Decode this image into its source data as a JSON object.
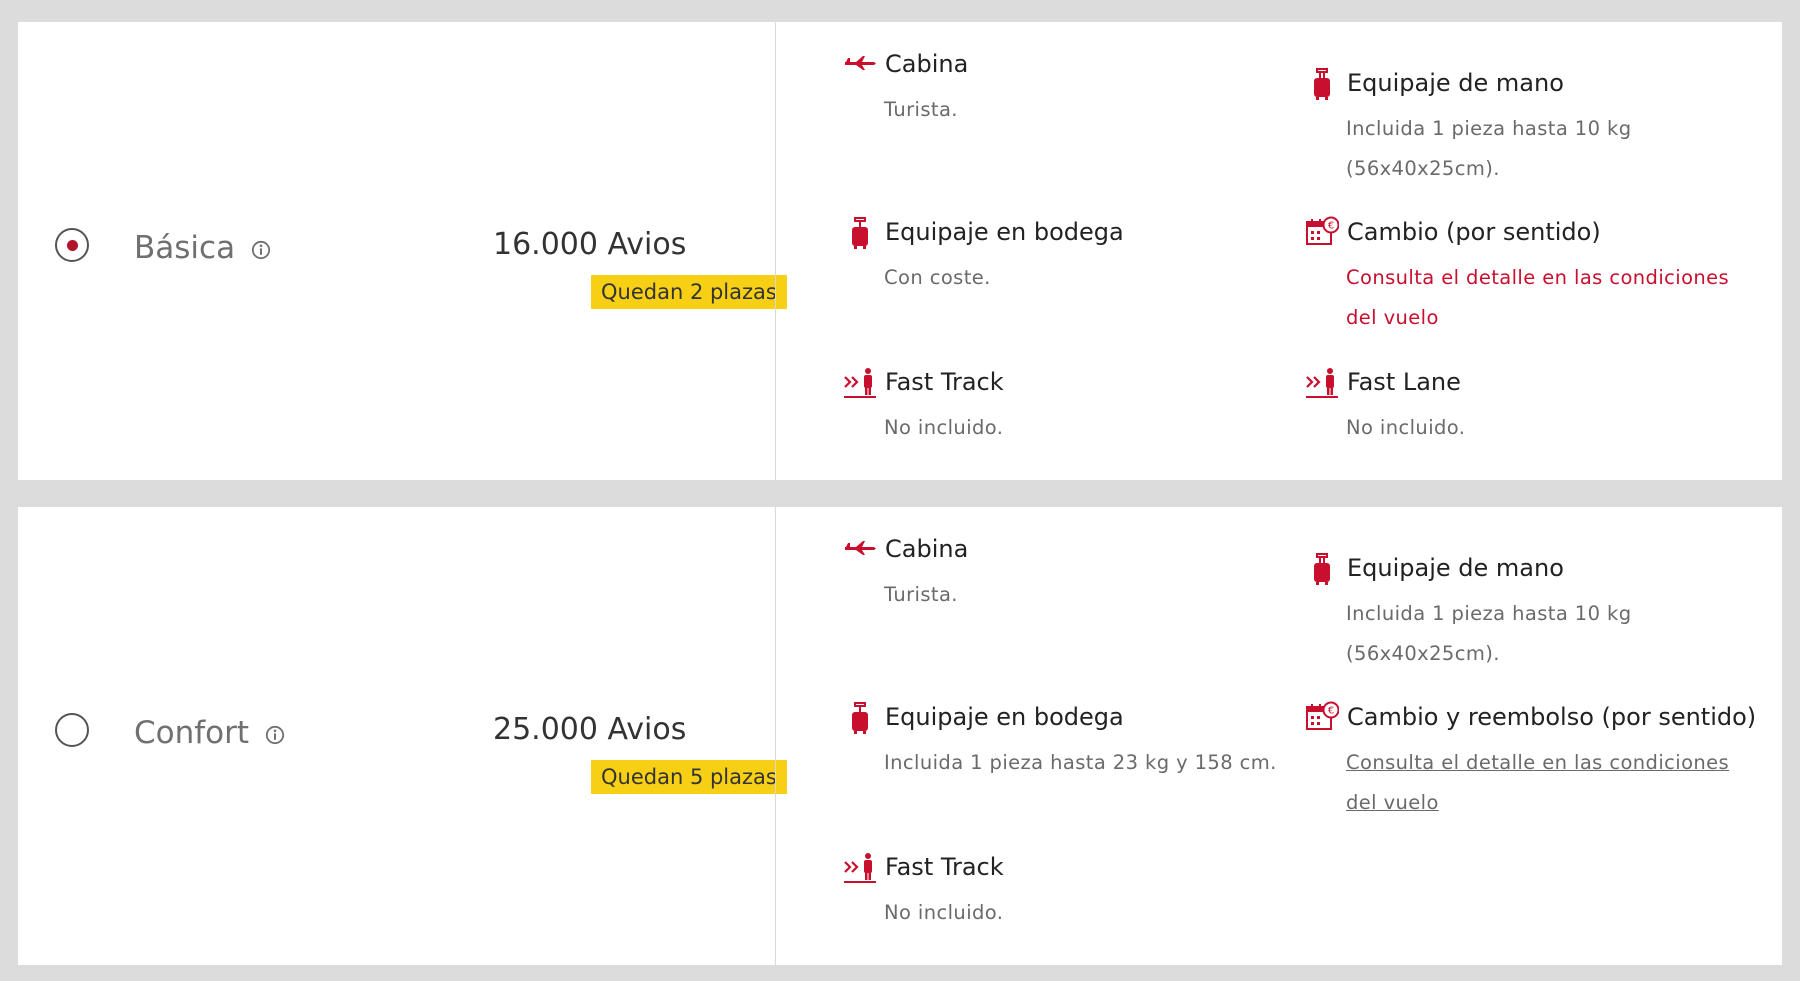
{
  "accent_color": "#c8102e",
  "badge_color": "#f7d016",
  "fares": [
    {
      "name": "Básica",
      "selected": true,
      "price": "16.000 Avios",
      "seats": "Quedan 2 plazas",
      "features": {
        "cabin": {
          "icon": "plane-icon",
          "title": "Cabina",
          "desc": "Turista."
        },
        "hand_baggage": {
          "icon": "suitcase-icon",
          "title": "Equipaje de mano",
          "desc": "Incluida 1 pieza hasta 10 kg (56x40x25cm)."
        },
        "hold_baggage": {
          "icon": "suitcase-icon",
          "title": "Equipaje en bodega",
          "desc": "Con coste."
        },
        "change": {
          "icon": "calendar-euro-icon",
          "title": "Cambio (por sentido)",
          "desc": "Consulta el detalle en las condiciones del vuelo"
        },
        "fast_track": {
          "icon": "fast-track-icon",
          "title": "Fast Track",
          "desc": "No incluido."
        },
        "fast_lane": {
          "icon": "fast-track-icon",
          "title": "Fast Lane",
          "desc": "No incluido."
        }
      }
    },
    {
      "name": "Confort",
      "selected": false,
      "price": "25.000 Avios",
      "seats": "Quedan 5 plazas",
      "features": {
        "cabin": {
          "icon": "plane-icon",
          "title": "Cabina",
          "desc": "Turista."
        },
        "hand_baggage": {
          "icon": "suitcase-icon",
          "title": "Equipaje de mano",
          "desc": "Incluida 1 pieza hasta 10 kg (56x40x25cm)."
        },
        "hold_baggage": {
          "icon": "suitcase-icon",
          "title": "Equipaje en bodega",
          "desc": "Incluida 1 pieza hasta 23 kg y 158 cm."
        },
        "change": {
          "icon": "calendar-euro-icon",
          "title": "Cambio y reembolso (por sentido)",
          "desc": "Consulta el detalle en las condiciones del vuelo"
        },
        "fast_track": {
          "icon": "fast-track-icon",
          "title": "Fast Track",
          "desc": "No incluido."
        }
      }
    }
  ]
}
